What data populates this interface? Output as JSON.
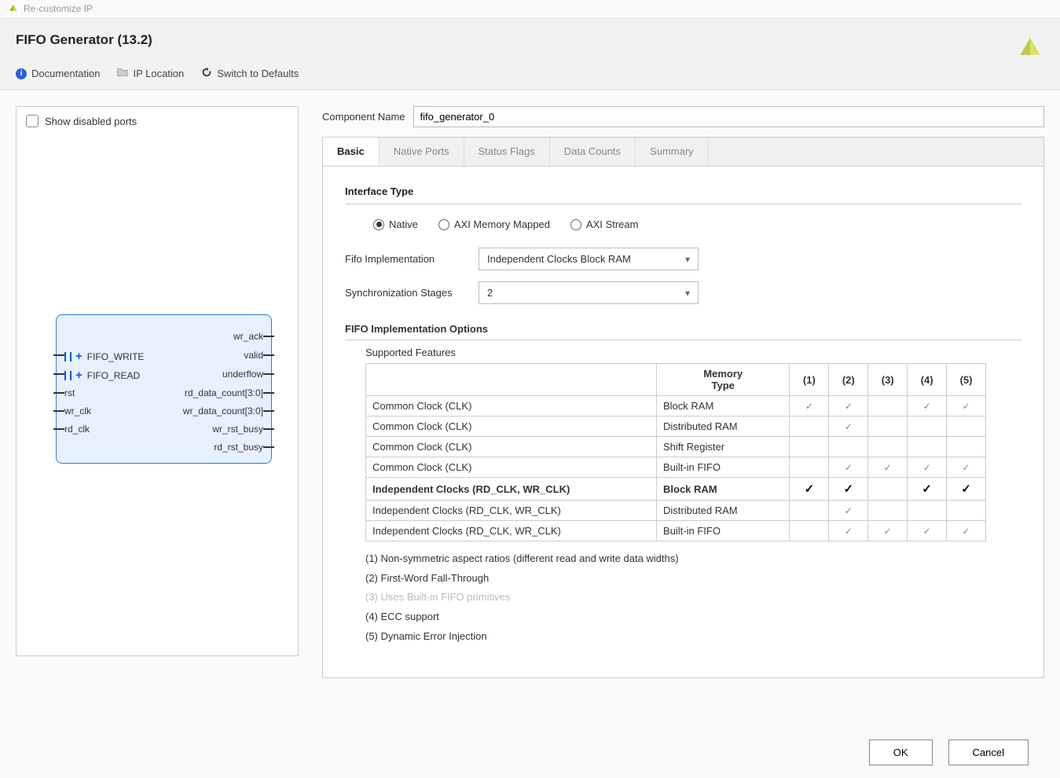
{
  "window": {
    "title": "Re-customize IP"
  },
  "header": {
    "title": "FIFO Generator (13.2)",
    "links": {
      "documentation": "Documentation",
      "ip_location": "IP Location",
      "switch_defaults": "Switch to Defaults"
    }
  },
  "left": {
    "show_disabled_label": "Show disabled ports",
    "block": {
      "fifo_write": "FIFO_WRITE",
      "fifo_read": "FIFO_READ",
      "rst": "rst",
      "wr_clk": "wr_clk",
      "rd_clk": "rd_clk",
      "wr_ack": "wr_ack",
      "valid": "valid",
      "underflow": "underflow",
      "rd_data_count": "rd_data_count[3:0]",
      "wr_data_count": "wr_data_count[3:0]",
      "wr_rst_busy": "wr_rst_busy",
      "rd_rst_busy": "rd_rst_busy"
    }
  },
  "component": {
    "label": "Component Name",
    "value": "fifo_generator_0"
  },
  "tabs": [
    "Basic",
    "Native Ports",
    "Status Flags",
    "Data Counts",
    "Summary"
  ],
  "active_tab": "Basic",
  "basic": {
    "interface_type_label": "Interface Type",
    "interface_options": {
      "native": "Native",
      "axi_mm": "AXI Memory Mapped",
      "axi_stream": "AXI Stream"
    },
    "interface_selected": "native",
    "fifo_impl_label": "Fifo Implementation",
    "fifo_impl_value": "Independent Clocks Block RAM",
    "sync_stages_label": "Synchronization Stages",
    "sync_stages_value": "2",
    "options_title": "FIFO Implementation Options",
    "supported_label": "Supported Features",
    "table": {
      "headers": {
        "mem": "Memory\nType",
        "c1": "(1)",
        "c2": "(2)",
        "c3": "(3)",
        "c4": "(4)",
        "c5": "(5)"
      },
      "rows": [
        {
          "name": "Common Clock (CLK)",
          "mem": "Block RAM",
          "c1": "g",
          "c2": "g",
          "c3": "",
          "c4": "g",
          "c5": "g",
          "selected": false
        },
        {
          "name": "Common Clock (CLK)",
          "mem": "Distributed RAM",
          "c1": "",
          "c2": "g",
          "c3": "",
          "c4": "",
          "c5": "",
          "selected": false
        },
        {
          "name": "Common Clock (CLK)",
          "mem": "Shift Register",
          "c1": "",
          "c2": "",
          "c3": "",
          "c4": "",
          "c5": "",
          "selected": false
        },
        {
          "name": "Common Clock (CLK)",
          "mem": "Built-in FIFO",
          "c1": "",
          "c2": "g",
          "c3": "g",
          "c4": "g",
          "c5": "g",
          "selected": false
        },
        {
          "name": "Independent Clocks (RD_CLK, WR_CLK)",
          "mem": "Block RAM",
          "c1": "b",
          "c2": "b",
          "c3": "",
          "c4": "b",
          "c5": "b",
          "selected": true
        },
        {
          "name": "Independent Clocks (RD_CLK, WR_CLK)",
          "mem": "Distributed RAM",
          "c1": "",
          "c2": "g",
          "c3": "",
          "c4": "",
          "c5": "",
          "selected": false
        },
        {
          "name": "Independent Clocks (RD_CLK, WR_CLK)",
          "mem": "Built-in FIFO",
          "c1": "",
          "c2": "g",
          "c3": "g",
          "c4": "g",
          "c5": "g",
          "selected": false
        }
      ]
    },
    "legend": {
      "l1": "(1) Non-symmetric aspect ratios (different read and write data widths)",
      "l2": "(2) First-Word Fall-Through",
      "l3": "(3) Uses Built-in FIFO primitives",
      "l4": "(4) ECC support",
      "l5": "(5) Dynamic Error Injection"
    }
  },
  "footer": {
    "ok": "OK",
    "cancel": "Cancel"
  }
}
